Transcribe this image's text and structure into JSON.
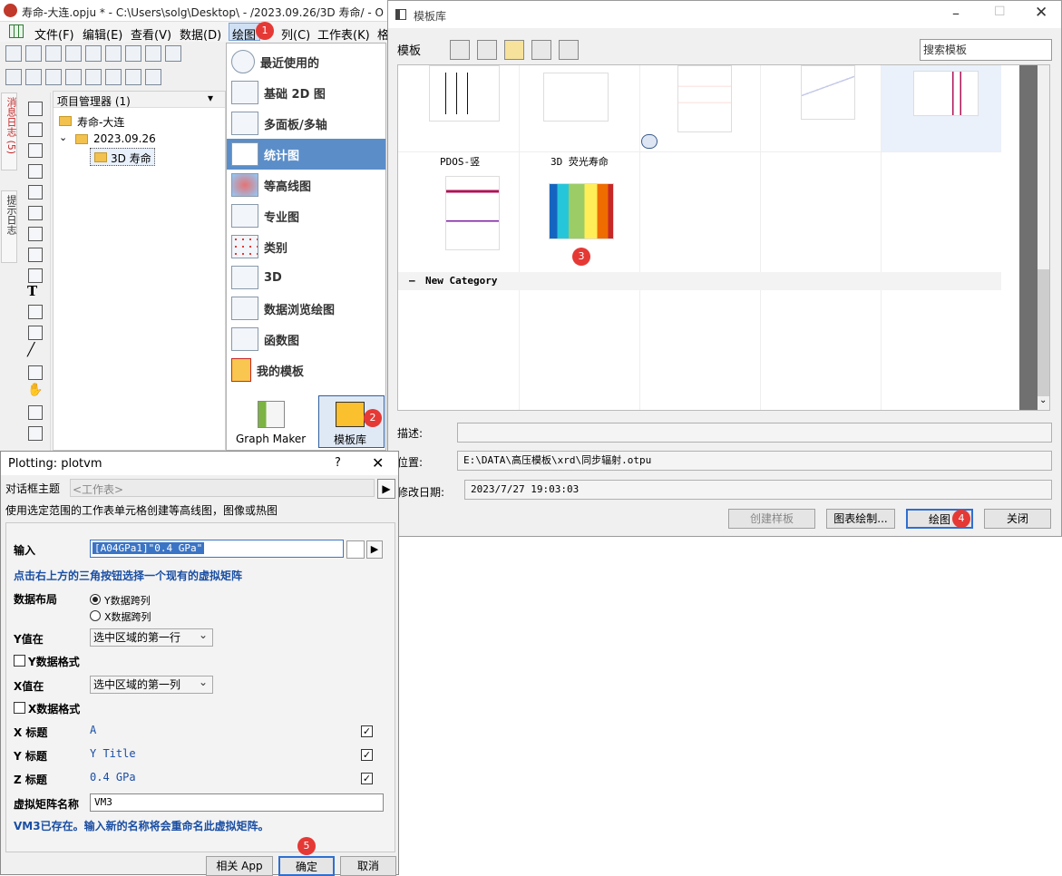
{
  "origin": {
    "title_bar": "寿命-大连.opju * - C:\\Users\\solg\\Desktop\\ - /2023.09.26/3D 寿命/ - O",
    "menu": [
      "文件(F)",
      "编辑(E)",
      "查看(V)",
      "数据(D)",
      "绘图",
      "列(C)",
      "工作表(K)",
      "格"
    ],
    "side_tabs": [
      "消息日志 (5)",
      "提示日志"
    ],
    "project_manager": {
      "title": "项目管理器 (1)",
      "tree": [
        "寿命-大连",
        "2023.09.26",
        "3D 寿命"
      ]
    },
    "plot_menu": {
      "items": [
        "最近使用的",
        "基础 2D 图",
        "多面板/多轴",
        "统计图",
        "等高线图",
        "专业图",
        "类别",
        "3D",
        "数据浏览绘图",
        "函数图",
        "我的模板"
      ],
      "active_index": 3,
      "bottom": [
        "Graph Maker",
        "模板库"
      ]
    }
  },
  "template_library": {
    "title": "模板库",
    "label": "模板",
    "search_placeholder": "搜索模板",
    "thumbnails_row2": [
      "PDOS-竖",
      "3D 荧光寿命"
    ],
    "category": "New Category",
    "desc_label": "描述:",
    "desc_value": "",
    "location_label": "位置:",
    "location_value": "E:\\DATA\\高压模板\\xrd\\同步辐射.otpu",
    "modified_label": "修改日期:",
    "modified_value": "2023/7/27 19:03:03",
    "buttons": [
      "创建样板",
      "图表绘制...",
      "绘图",
      "关闭"
    ]
  },
  "plotvm": {
    "title": "Plotting: plotvm",
    "help": "?",
    "theme_label": "对话框主题",
    "theme_value": "<工作表>",
    "description": "使用选定范围的工作表单元格创建等高线图，图像或热图",
    "input_label": "输入",
    "input_value": "[A04GPa1]\"0.4 GPa\"",
    "hint": "点击右上方的三角按钮选择一个现有的虚拟矩阵",
    "layout_label": "数据布局",
    "layout_options": [
      "Y数据跨列",
      "X数据跨列"
    ],
    "y_value_label": "Y值在",
    "y_value": "选中区域的第一行",
    "y_format_label": "Y数据格式",
    "x_value_label": "X值在",
    "x_value": "选中区域的第一列",
    "x_format_label": "X数据格式",
    "x_title_label": "X 标题",
    "x_title": "A",
    "y_title_label": "Y 标题",
    "y_title": "Y Title",
    "z_title_label": "Z 标题",
    "z_title": "0.4 GPa",
    "vm_name_label": "虚拟矩阵名称",
    "vm_name": "VM3",
    "warning": "VM3已存在。输入新的名称将会重命名此虚拟矩阵。",
    "buttons": [
      "相关 App",
      "确定",
      "取消"
    ]
  },
  "badges": [
    "1",
    "2",
    "3",
    "4",
    "5"
  ]
}
